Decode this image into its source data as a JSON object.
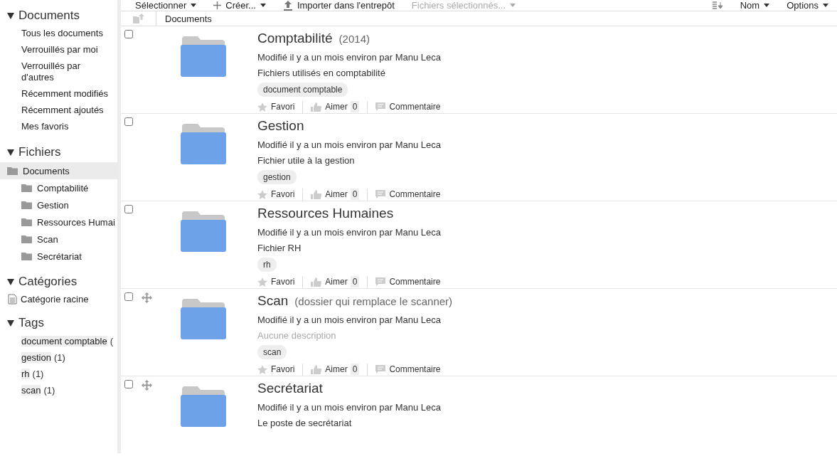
{
  "sidebar": {
    "sections": [
      {
        "kind": "links",
        "title": "Documents",
        "expanded": true,
        "items": [
          {
            "label": "Tous les documents"
          },
          {
            "label": "Verrouillés par moi"
          },
          {
            "label": "Verrouillés par d'autres"
          },
          {
            "label": "Récemment modifiés"
          },
          {
            "label": "Récemment ajoutés"
          },
          {
            "label": "Mes favoris"
          }
        ]
      },
      {
        "kind": "tree",
        "title": "Fichiers",
        "expanded": true,
        "items": [
          {
            "label": "Documents",
            "selected": true,
            "children": [
              {
                "label": "Comptabilité",
                "selected": false
              },
              {
                "label": "Gestion",
                "selected": false
              },
              {
                "label": "Ressources Humai",
                "selected": false
              },
              {
                "label": "Scan",
                "selected": false
              },
              {
                "label": "Secrétariat",
                "selected": false
              }
            ]
          }
        ]
      },
      {
        "kind": "categories",
        "title": "Catégories",
        "expanded": true,
        "items": [
          {
            "label": "Catégorie racine"
          }
        ]
      },
      {
        "kind": "tags",
        "title": "Tags",
        "expanded": true,
        "items": [
          {
            "label": "document comptable",
            "count": "("
          },
          {
            "label": "gestion",
            "count": "(1)"
          },
          {
            "label": "rh",
            "count": "(1)"
          },
          {
            "label": "scan",
            "count": "(1)"
          }
        ]
      }
    ]
  },
  "toolbar": {
    "select": "Sélectionner",
    "create": "Créer...",
    "upload": "Importer dans l'entrepôt",
    "selected_files": {
      "label": "Fichiers sélectionnés...",
      "disabled": true
    },
    "sort": "Nom",
    "options": "Options"
  },
  "breadcrumb": {
    "path": "Documents"
  },
  "items": [
    {
      "title": "Comptabilité",
      "subtitle": "(2014)",
      "movable": false,
      "checked": false,
      "modified": "Modifié il y a un mois environ par Manu Leca",
      "description": "Fichiers utilisés en comptabilité",
      "description_empty": false,
      "tags": [
        "document comptable"
      ],
      "actions": {
        "favorite": "Favori",
        "like": "Aimer",
        "likes": "0",
        "comment": "Commentaire"
      }
    },
    {
      "title": "Gestion",
      "movable": false,
      "checked": false,
      "modified": "Modifié il y a un mois environ par Manu Leca",
      "description": "Fichier utile à la gestion",
      "description_empty": false,
      "tags": [
        "gestion"
      ],
      "actions": {
        "favorite": "Favori",
        "like": "Aimer",
        "likes": "0",
        "comment": "Commentaire"
      }
    },
    {
      "title": "Ressources Humaines",
      "movable": false,
      "checked": false,
      "modified": "Modifié il y a un mois environ par Manu Leca",
      "description": "Fichier RH",
      "description_empty": false,
      "tags": [
        "rh"
      ],
      "actions": {
        "favorite": "Favori",
        "like": "Aimer",
        "likes": "0",
        "comment": "Commentaire"
      }
    },
    {
      "title": "Scan",
      "subtitle": "(dossier qui remplace le scanner)",
      "movable": true,
      "checked": false,
      "modified": "Modifié il y a un mois environ par Manu Leca",
      "description": "Aucune description",
      "description_empty": true,
      "tags": [
        "scan"
      ],
      "actions": {
        "favorite": "Favori",
        "like": "Aimer",
        "likes": "0",
        "comment": "Commentaire"
      }
    },
    {
      "title": "Secrétariat",
      "movable": true,
      "checked": false,
      "modified": "Modifié il y a un mois environ par Manu Leca",
      "description": "Le poste de secrétariat",
      "description_empty": false
    }
  ]
}
